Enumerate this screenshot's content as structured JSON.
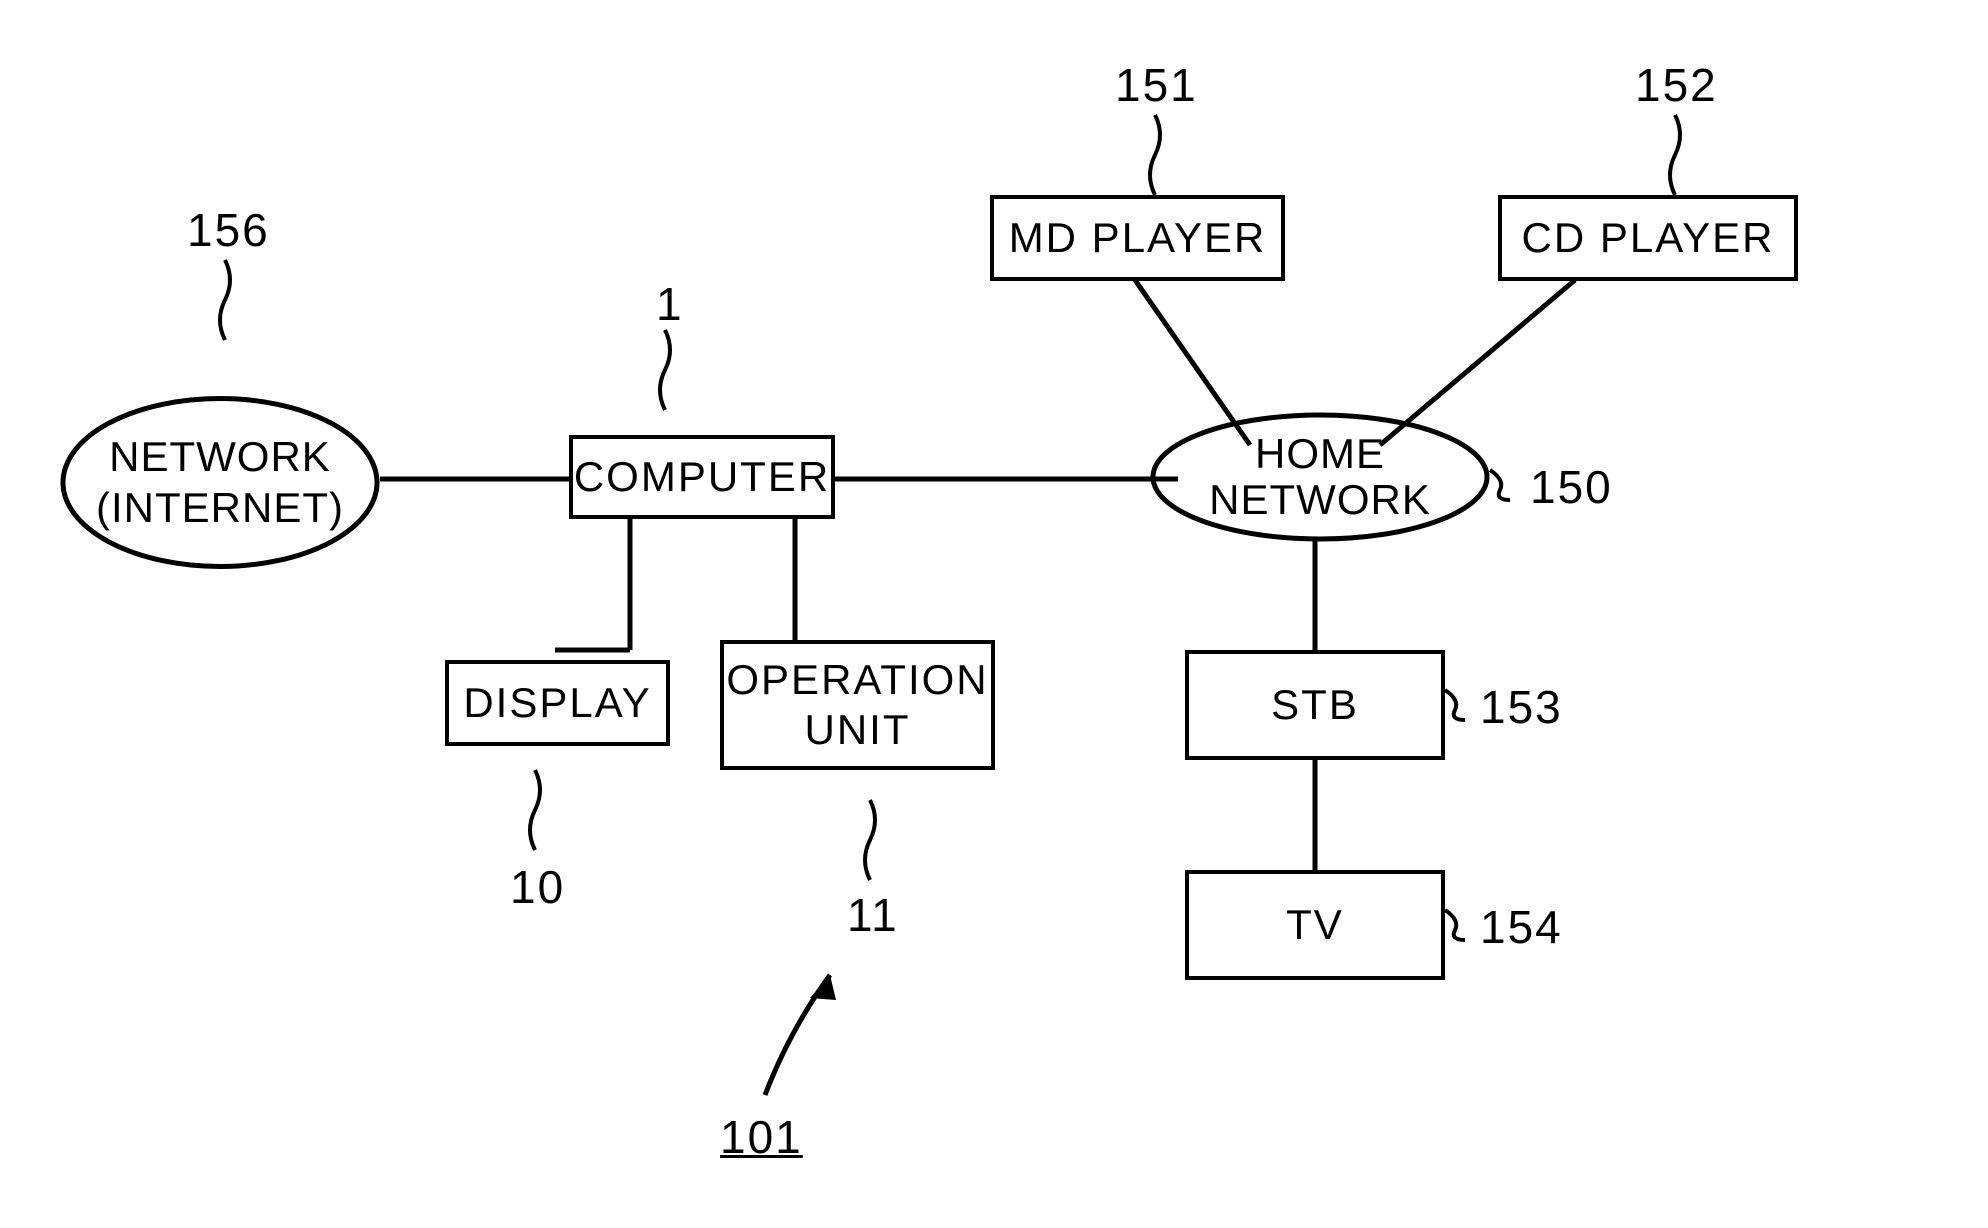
{
  "nodes": {
    "network": {
      "label": "NETWORK\n(INTERNET)",
      "ref": "156"
    },
    "computer": {
      "label": "COMPUTER",
      "ref": "1"
    },
    "display": {
      "label": "DISPLAY",
      "ref": "10"
    },
    "operation_unit": {
      "label": "OPERATION\nUNIT",
      "ref": "11"
    },
    "home_network": {
      "label": "HOME\nNETWORK",
      "ref": "150"
    },
    "md_player": {
      "label": "MD PLAYER",
      "ref": "151"
    },
    "cd_player": {
      "label": "CD PLAYER",
      "ref": "152"
    },
    "stb": {
      "label": "STB",
      "ref": "153"
    },
    "tv": {
      "label": "TV",
      "ref": "154"
    }
  },
  "figure_ref": "101"
}
